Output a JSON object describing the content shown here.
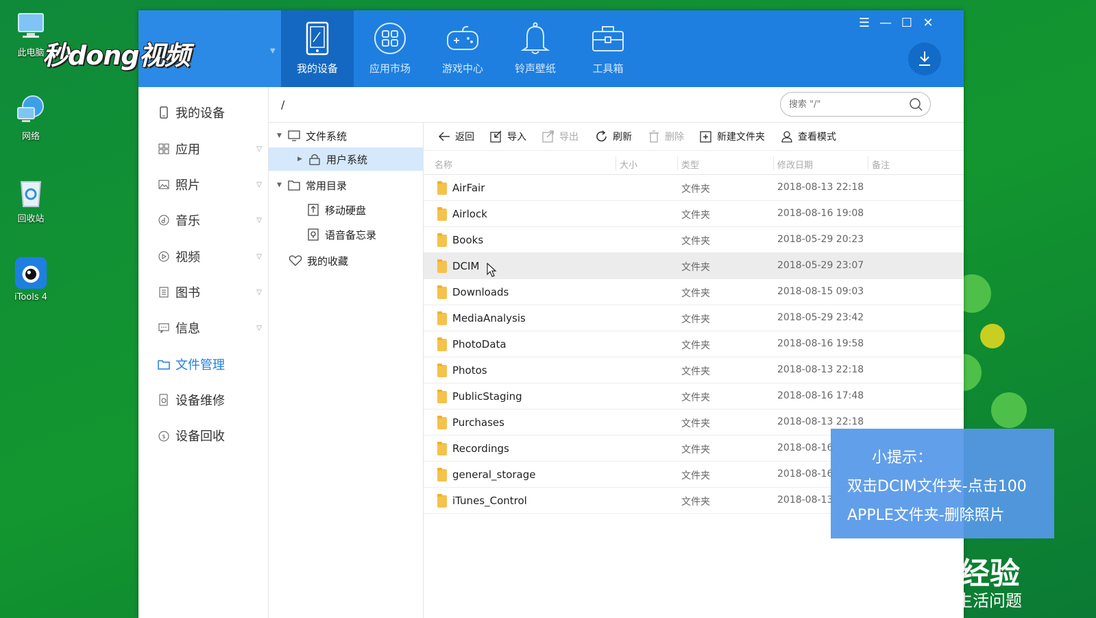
{
  "desktop": {
    "icons": [
      {
        "label": "此电脑",
        "icon": "computer-icon"
      },
      {
        "label": "网络",
        "icon": "network-icon"
      },
      {
        "label": "回收站",
        "icon": "recycle-bin-icon"
      },
      {
        "label": "iTools 4",
        "icon": "itools-icon"
      }
    ]
  },
  "watermark": {
    "brand": "秒dong视频",
    "jy_logo": "经验",
    "jy_sub": "生活问题"
  },
  "nav": {
    "tabs": [
      {
        "label": "我的设备",
        "icon": "phone-icon"
      },
      {
        "label": "应用市场",
        "icon": "apps-icon"
      },
      {
        "label": "游戏中心",
        "icon": "gamepad-icon"
      },
      {
        "label": "铃声壁纸",
        "icon": "bell-icon"
      },
      {
        "label": "工具箱",
        "icon": "toolbox-icon"
      }
    ]
  },
  "sidebar": {
    "items": [
      {
        "label": "我的设备"
      },
      {
        "label": "应用"
      },
      {
        "label": "照片"
      },
      {
        "label": "音乐"
      },
      {
        "label": "视频"
      },
      {
        "label": "图书"
      },
      {
        "label": "信息"
      },
      {
        "label": "文件管理"
      },
      {
        "label": "设备维修"
      },
      {
        "label": "设备回收"
      }
    ]
  },
  "pathbar": {
    "path": "/",
    "search_placeholder": "搜索 \"/\""
  },
  "tree": {
    "filesystem": "文件系统",
    "user_system": "用户系统",
    "common_dirs": "常用目录",
    "mobile_disk": "移动硬盘",
    "voice_memo": "语音备忘录",
    "favorites": "我的收藏"
  },
  "toolbar": {
    "back": "返回",
    "import": "导入",
    "export": "导出",
    "refresh": "刷新",
    "delete": "删除",
    "new_folder": "新建文件夹",
    "view_mode": "查看模式"
  },
  "table": {
    "headers": {
      "name": "名称",
      "size": "大小",
      "type": "类型",
      "modified": "修改日期",
      "note": "备注"
    },
    "rows": [
      {
        "name": "AirFair",
        "type": "文件夹",
        "modified": "2018-08-13 22:18"
      },
      {
        "name": "Airlock",
        "type": "文件夹",
        "modified": "2018-08-16 19:08"
      },
      {
        "name": "Books",
        "type": "文件夹",
        "modified": "2018-05-29 20:23"
      },
      {
        "name": "DCIM",
        "type": "文件夹",
        "modified": "2018-05-29 23:07"
      },
      {
        "name": "Downloads",
        "type": "文件夹",
        "modified": "2018-08-15 09:03"
      },
      {
        "name": "MediaAnalysis",
        "type": "文件夹",
        "modified": "2018-05-29 23:42"
      },
      {
        "name": "PhotoData",
        "type": "文件夹",
        "modified": "2018-08-16 19:58"
      },
      {
        "name": "Photos",
        "type": "文件夹",
        "modified": "2018-08-13 22:18"
      },
      {
        "name": "PublicStaging",
        "type": "文件夹",
        "modified": "2018-08-16 17:48"
      },
      {
        "name": "Purchases",
        "type": "文件夹",
        "modified": "2018-08-13 22:18"
      },
      {
        "name": "Recordings",
        "type": "文件夹",
        "modified": "2018-08-16"
      },
      {
        "name": "general_storage",
        "type": "文件夹",
        "modified": "2018-08-16"
      },
      {
        "name": "iTunes_Control",
        "type": "文件夹",
        "modified": "2018-08-13"
      }
    ]
  },
  "tip": {
    "title": "小提示：",
    "line1": "双击DCIM文件夹-点击100",
    "line2": "APPLE文件夹-删除照片"
  },
  "colors": {
    "accent": "#1e7fe0",
    "active_tab": "#1468c2",
    "desktop": "#13962f"
  }
}
